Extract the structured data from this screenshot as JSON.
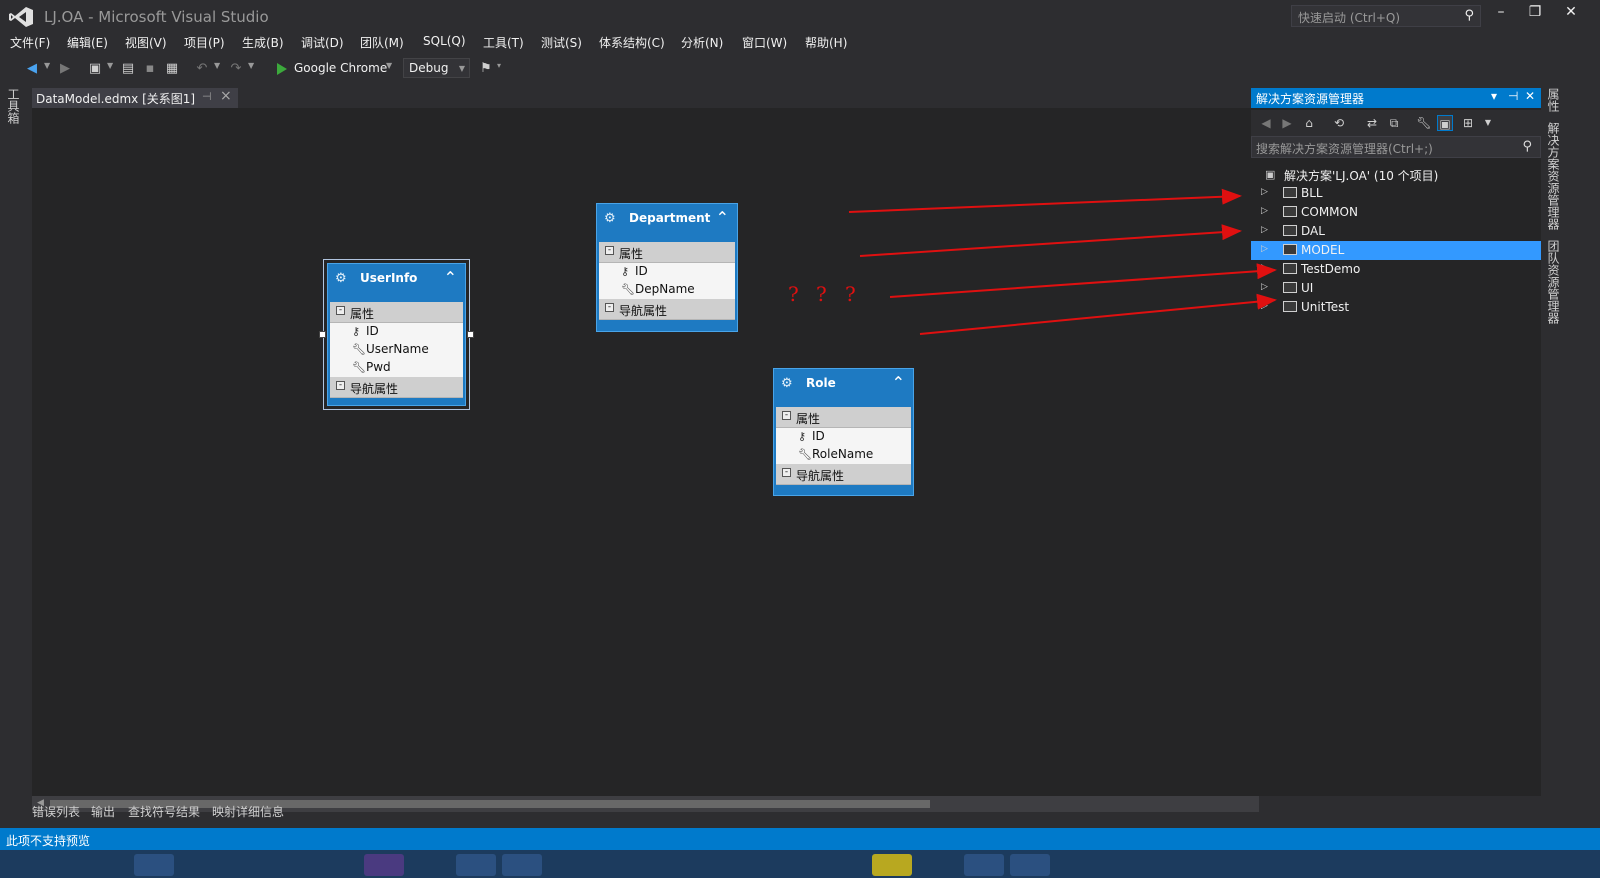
{
  "window": {
    "title": "LJ.OA - Microsoft Visual Studio",
    "quick_launch_placeholder": "快速启动 (Ctrl+Q)"
  },
  "menu": [
    "文件(F)",
    "编辑(E)",
    "视图(V)",
    "项目(P)",
    "生成(B)",
    "调试(D)",
    "团队(M)",
    "SQL(Q)",
    "工具(T)",
    "测试(S)",
    "体系结构(C)",
    "分析(N)",
    "窗口(W)",
    "帮助(H)"
  ],
  "toolbar": {
    "run_target": "Google Chrome",
    "configuration": "Debug"
  },
  "left_tab": "工具箱",
  "document_tab": {
    "label": "DataModel.edmx [关系图1]"
  },
  "entities": [
    {
      "name": "UserInfo",
      "properties_header": "属性",
      "properties": [
        "ID",
        "UserName",
        "Pwd"
      ],
      "nav_header": "导航属性"
    },
    {
      "name": "Department",
      "properties_header": "属性",
      "properties": [
        "ID",
        "DepName"
      ],
      "nav_header": "导航属性"
    },
    {
      "name": "Role",
      "properties_header": "属性",
      "properties": [
        "ID",
        "RoleName"
      ],
      "nav_header": "导航属性"
    }
  ],
  "annotation": {
    "question_marks": [
      "?",
      "?",
      "?"
    ],
    "color": "#e01010"
  },
  "solution_explorer": {
    "title": "解决方案资源管理器",
    "search_placeholder": "搜索解决方案资源管理器(Ctrl+;)",
    "root": "解决方案'LJ.OA' (10 个项目)",
    "projects": [
      "BLL",
      "COMMON",
      "DAL",
      "MODEL",
      "TestDemo",
      "UI",
      "UnitTest"
    ],
    "selected": "MODEL"
  },
  "right_tabs": [
    "属性",
    "解决方案资源管理器",
    "团队资源管理器"
  ],
  "bottom_tabs": [
    "错误列表",
    "输出",
    "查找符号结果",
    "映射详细信息"
  ],
  "status": "此项不支持预览",
  "colors": {
    "accent": "#007acc",
    "entity_header": "#1e7ac2",
    "background": "#2d2d30",
    "canvas": "#252526"
  }
}
